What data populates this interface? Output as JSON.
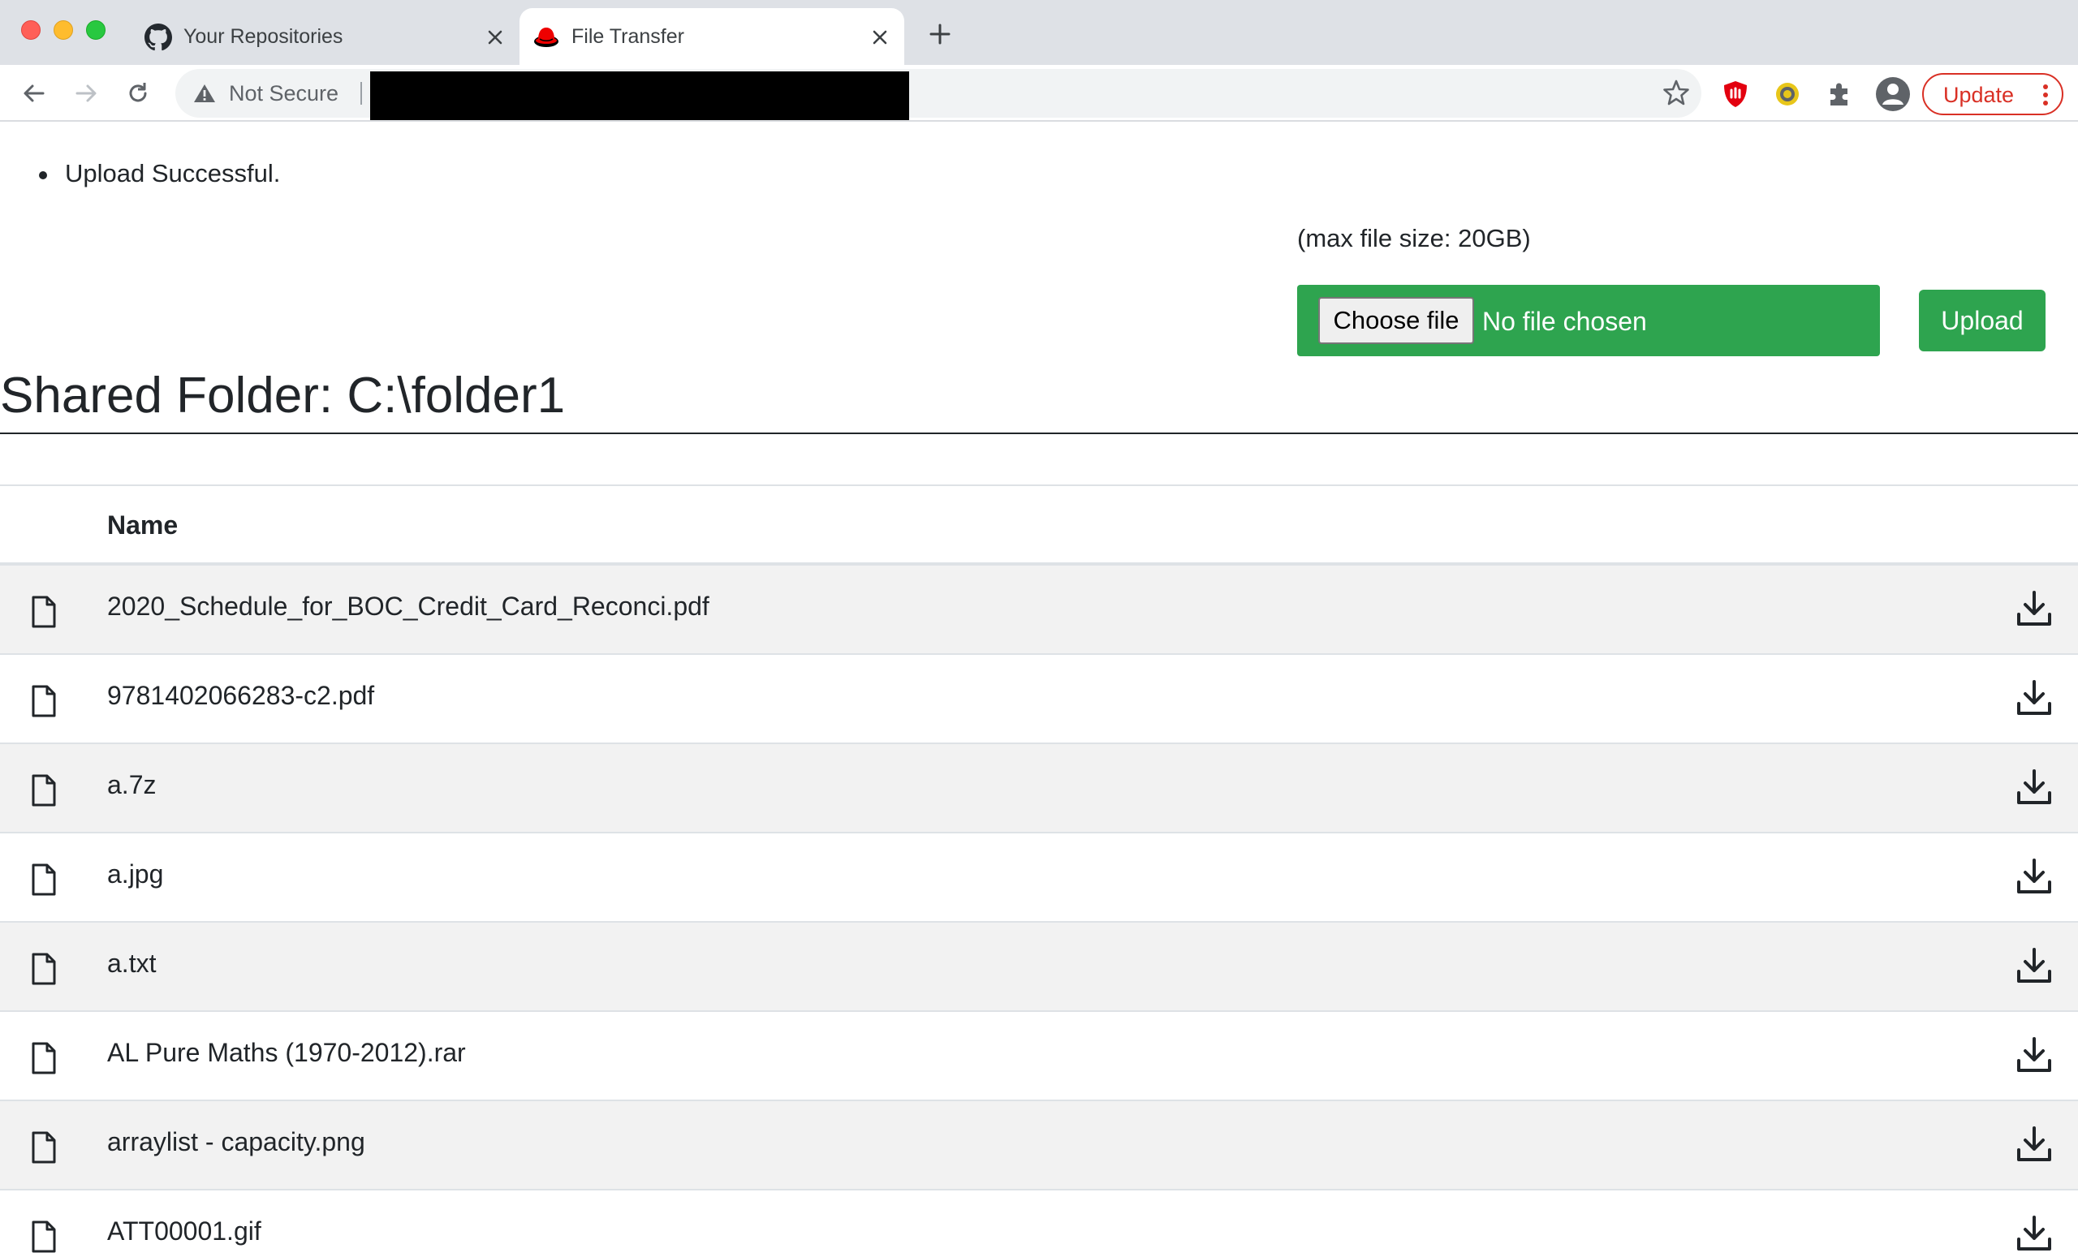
{
  "browser": {
    "tabs": [
      {
        "title": "Your Repositories",
        "icon": "github-icon"
      },
      {
        "title": "File Transfer",
        "icon": "redhat-icon",
        "active": true
      }
    ],
    "omnibox": {
      "security_label": "Not Secure",
      "url_redacted": true
    },
    "update_label": "Update",
    "colors": {
      "update": "#d93025",
      "tabstrip": "#dee1e6"
    }
  },
  "page": {
    "messages": [
      "Upload Successful."
    ],
    "upload": {
      "max_size_text": "(max file size: 20GB)",
      "choose_file_label": "Choose file",
      "no_file_text": "No file chosen",
      "upload_label": "Upload",
      "accent": "#2ea44f"
    },
    "folder_title": "Shared Folder: C:\\folder1",
    "table": {
      "columns": [
        "",
        "Name",
        ""
      ],
      "rows": [
        {
          "name": "2020_Schedule_for_BOC_Credit_Card_Reconci.pdf"
        },
        {
          "name": "9781402066283-c2.pdf"
        },
        {
          "name": "a.7z"
        },
        {
          "name": "a.jpg"
        },
        {
          "name": "a.txt"
        },
        {
          "name": "AL Pure Maths (1970-2012).rar"
        },
        {
          "name": "arraylist - capacity.png"
        },
        {
          "name": "ATT00001.gif"
        }
      ]
    }
  }
}
